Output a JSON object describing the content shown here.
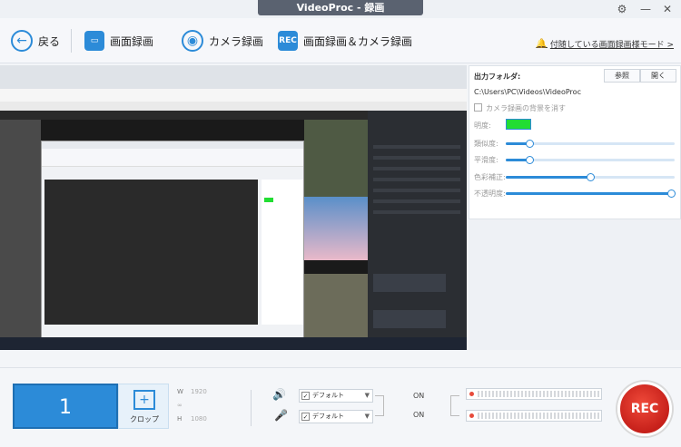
{
  "window": {
    "title": "VideoProc - 録画"
  },
  "toolbar": {
    "back_label": "戻る",
    "screen_label": "画面録画",
    "camera_label": "カメラ録画",
    "screen_camera_label": "画面録画＆カメラ録画",
    "rec_icon_text": "REC",
    "follow_label": "付随している画面録画様モード >"
  },
  "output": {
    "folder_label": "出力フォルダ:",
    "browse_label": "参照",
    "open_label": "開く",
    "path": "C:\\Users\\PC\\Videos\\VideoProc",
    "remove_bg_label": "カメラ録画の背景を消す",
    "brightness_label": "明度:",
    "similarity_label": "類似度:",
    "smoothness_label": "平滑度:",
    "color_correction_label": "色彩補正:",
    "opacity_label": "不透明度:",
    "similarity_value": 0.14,
    "smoothness_value": 0.14,
    "color_correction_value": 0.5,
    "opacity_value": 0.98,
    "brightness_color": "#22dd33"
  },
  "bottom": {
    "monitor_number": "1",
    "crop_label": "クロップ",
    "width_label": "W",
    "height_label": "H",
    "width_value": "1920",
    "height_value": "1080",
    "speaker_device": "デフォルト",
    "mic_device": "デフォルト",
    "speaker_state": "ON",
    "mic_state": "ON",
    "rec_label": "REC"
  },
  "colors": {
    "accent": "#2c8bd8",
    "rec": "#d8281f"
  }
}
